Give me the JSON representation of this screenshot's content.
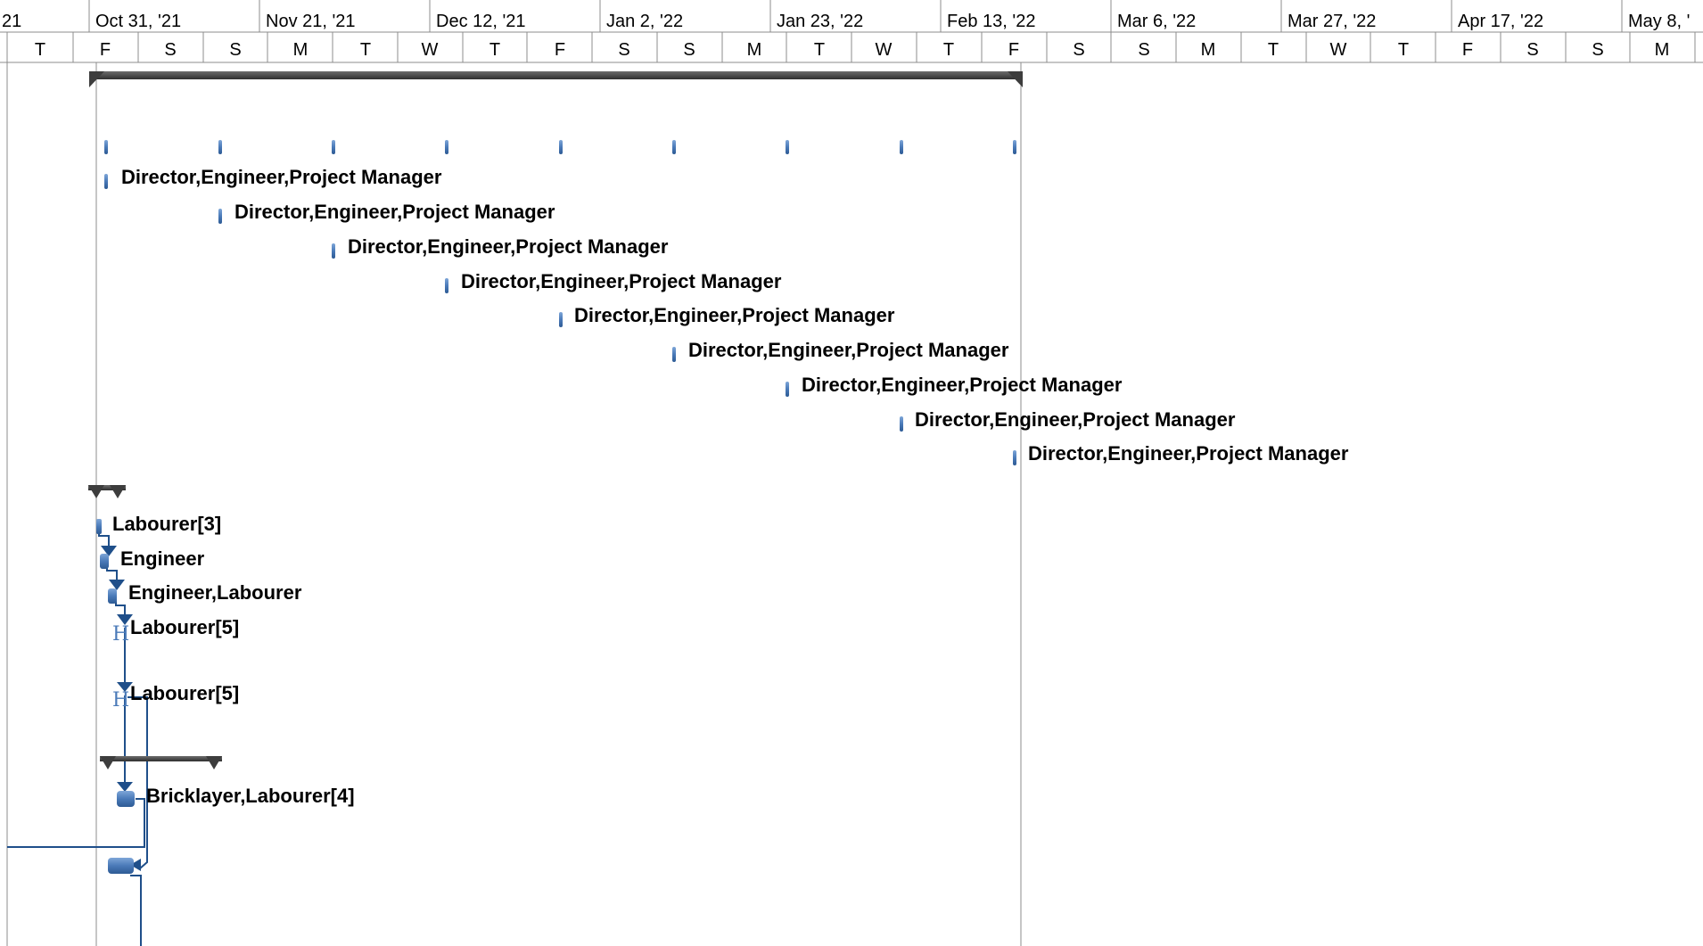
{
  "timescale": {
    "top_tier": [
      "21",
      "Oct 31, '21",
      "Nov 21, '21",
      "Dec 12, '21",
      "Jan 2, '22",
      "Jan 23, '22",
      "Feb 13, '22",
      "Mar 6, '22",
      "Mar 27, '22",
      "Apr 17, '22",
      "May 8, '"
    ],
    "bottom_tier": [
      "T",
      "F",
      "S",
      "S",
      "M",
      "T",
      "W",
      "T",
      "F",
      "S",
      "S",
      "M",
      "T",
      "W",
      "T",
      "F",
      "S",
      "S",
      "M",
      "T",
      "W",
      "T",
      "F",
      "S",
      "S",
      "M"
    ]
  },
  "resource_labels": [
    "Director,Engineer,Project Manager",
    "Director,Engineer,Project Manager",
    "Director,Engineer,Project Manager",
    "Director,Engineer,Project Manager",
    "Director,Engineer,Project Manager",
    "Director,Engineer,Project Manager",
    "Director,Engineer,Project Manager",
    "Director,Engineer,Project Manager",
    "Director,Engineer,Project Manager",
    "Labourer[3]",
    "Engineer",
    "Engineer,Labourer",
    "Labourer[5]",
    "Labourer[5]",
    "Bricklayer,Labourer[4]"
  ],
  "colors": {
    "task_bar": "#4a7ab8",
    "task_bar_dark": "#27558f",
    "summary_bar": "#3d3d3d",
    "link_line": "#1f4f8a",
    "grid": "#8c8c8c"
  }
}
